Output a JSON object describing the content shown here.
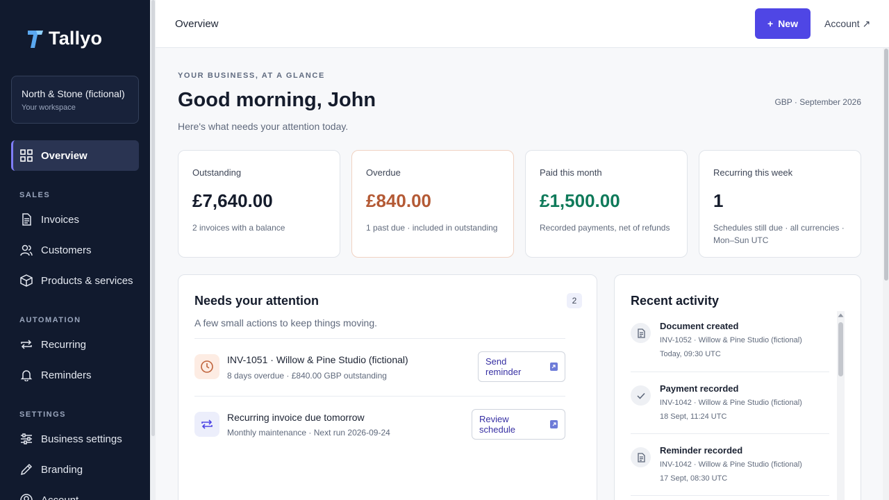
{
  "app": {
    "name": "Tallyo"
  },
  "workspace": {
    "name": "North & Stone (fictional)",
    "sub": "Your workspace"
  },
  "nav": {
    "overview": "Overview",
    "sections": {
      "sales": "SALES",
      "automation": "AUTOMATION",
      "settings": "SETTINGS"
    },
    "invoices": "Invoices",
    "customers": "Customers",
    "products": "Products & services",
    "recurring": "Recurring",
    "reminders": "Reminders",
    "business_settings": "Business settings",
    "branding": "Branding",
    "account": "Account"
  },
  "topbar": {
    "page": "Overview",
    "new_label": "New",
    "account_label": "Account ↗"
  },
  "header": {
    "eyebrow": "YOUR BUSINESS, AT A GLANCE",
    "greeting": "Good morning, John",
    "meta": "GBP · September 2026",
    "subline": "Here's what needs your attention today."
  },
  "kpis": [
    {
      "label": "Outstanding",
      "value": "£7,640.00",
      "note": "2 invoices with a balance"
    },
    {
      "label": "Overdue",
      "value": "£840.00",
      "note": "1 past due · included in outstanding"
    },
    {
      "label": "Paid this month",
      "value": "£1,500.00",
      "note": "Recorded payments, net of refunds"
    },
    {
      "label": "Recurring this week",
      "value": "1",
      "note": "Schedules still due · all currencies · Mon–Sun UTC"
    }
  ],
  "attention": {
    "title": "Needs your attention",
    "count": "2",
    "sub": "A few small actions to keep things moving.",
    "items": [
      {
        "title": "INV-1051 · Willow & Pine Studio (fictional)",
        "sub": "8 days overdue · £840.00 GBP outstanding",
        "action": "Send reminder"
      },
      {
        "title": "Recurring invoice due tomorrow",
        "sub": "Monthly maintenance · Next run 2026-09-24",
        "action": "Review schedule"
      }
    ]
  },
  "activity": {
    "title": "Recent activity",
    "items": [
      {
        "title": "Document created",
        "line1": "INV-1052 · Willow & Pine Studio (fictional)",
        "line2": "Today, 09:30 UTC"
      },
      {
        "title": "Payment recorded",
        "line1": "INV-1042 · Willow & Pine Studio (fictional)",
        "line2": "18 Sept, 11:24 UTC"
      },
      {
        "title": "Reminder recorded",
        "line1": "INV-1042 · Willow & Pine Studio (fictional)",
        "line2": "17 Sept, 08:30 UTC"
      }
    ]
  },
  "colors": {
    "accent": "#4f46e5",
    "sidebar": "#111a2e",
    "overdue": "#b45a35",
    "paid": "#0f7a5a"
  }
}
